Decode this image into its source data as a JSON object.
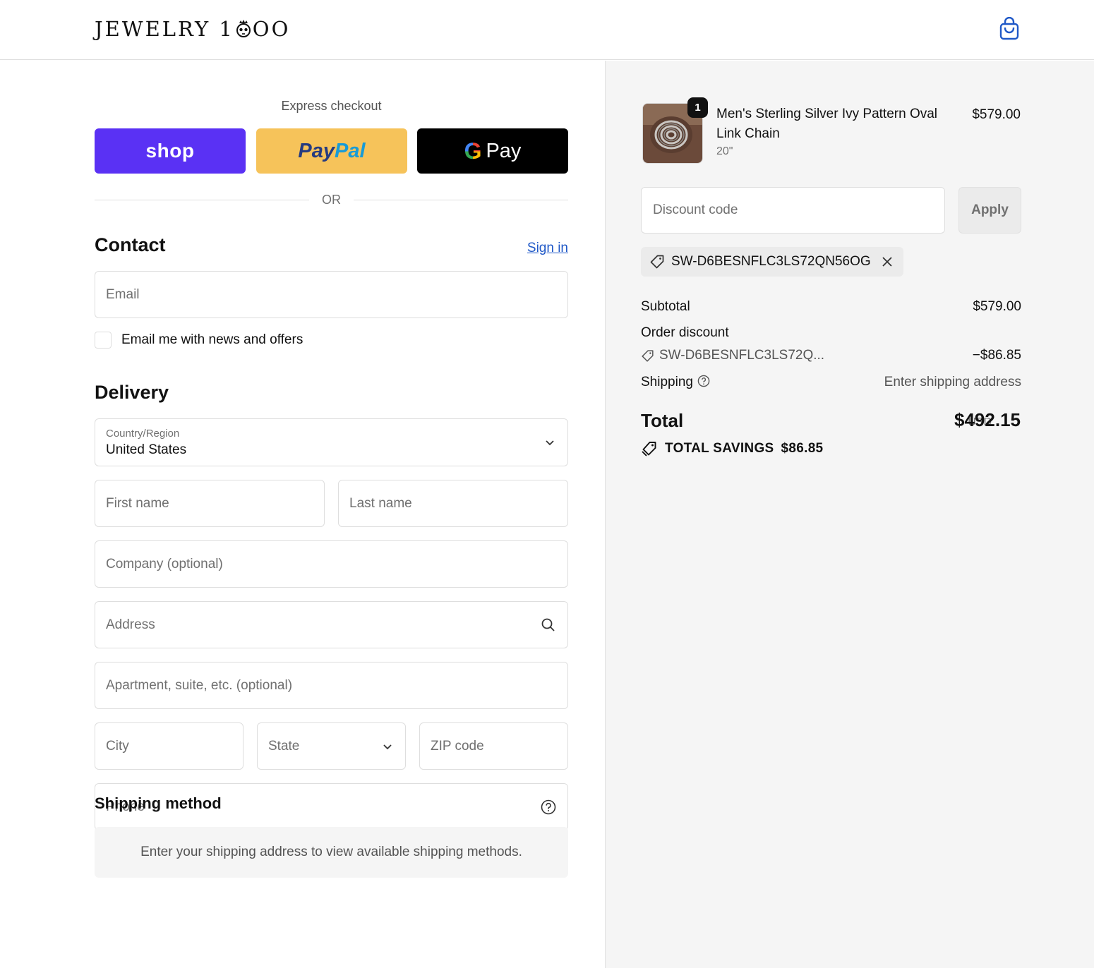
{
  "header": {
    "logo_text_left": "JEWELRY 1",
    "logo_text_right": "OO",
    "cart_icon": "shopping-bag-icon"
  },
  "express": {
    "title": "Express checkout",
    "shop_label": "shop",
    "paypal_label_1": "Pay",
    "paypal_label_2": "Pal",
    "gpay_g": "G",
    "gpay_label": "Pay",
    "or_label": "OR"
  },
  "contact": {
    "title": "Contact",
    "sign_in": "Sign in",
    "email_placeholder": "Email",
    "newsletter_label": "Email me with news and offers"
  },
  "delivery": {
    "title": "Delivery",
    "country_label": "Country/Region",
    "country_value": "United States",
    "first_name": "First name",
    "last_name": "Last name",
    "company": "Company (optional)",
    "address": "Address",
    "apartment": "Apartment, suite, etc. (optional)",
    "city": "City",
    "state": "State",
    "zip": "ZIP code",
    "phone": "Phone"
  },
  "shipping_method": {
    "title": "Shipping method",
    "message": "Enter your shipping address to view available shipping methods."
  },
  "order": {
    "quantity": "1",
    "product_name": "Men's Sterling Silver Ivy Pattern Oval Link Chain",
    "variant": "20\"",
    "price": "$579.00",
    "discount_placeholder": "Discount code",
    "apply_label": "Apply",
    "applied_code": "SW-D6BESNFLC3LS72QN56OG",
    "subtotal_label": "Subtotal",
    "subtotal_value": "$579.00",
    "order_discount_label": "Order discount",
    "discount_code_short": "SW-D6BESNFLC3LS72Q...",
    "discount_value": "−$86.85",
    "shipping_label": "Shipping",
    "shipping_value": "Enter shipping address",
    "total_label": "Total",
    "currency": "USD",
    "total_value": "$492.15",
    "savings_label": "TOTAL SAVINGS",
    "savings_value": "$86.85"
  },
  "colors": {
    "shop_purple": "#5a31f4",
    "paypal_yellow": "#f6c35a",
    "link_blue": "#1f58c7",
    "summary_bg": "#f5f5f5"
  }
}
